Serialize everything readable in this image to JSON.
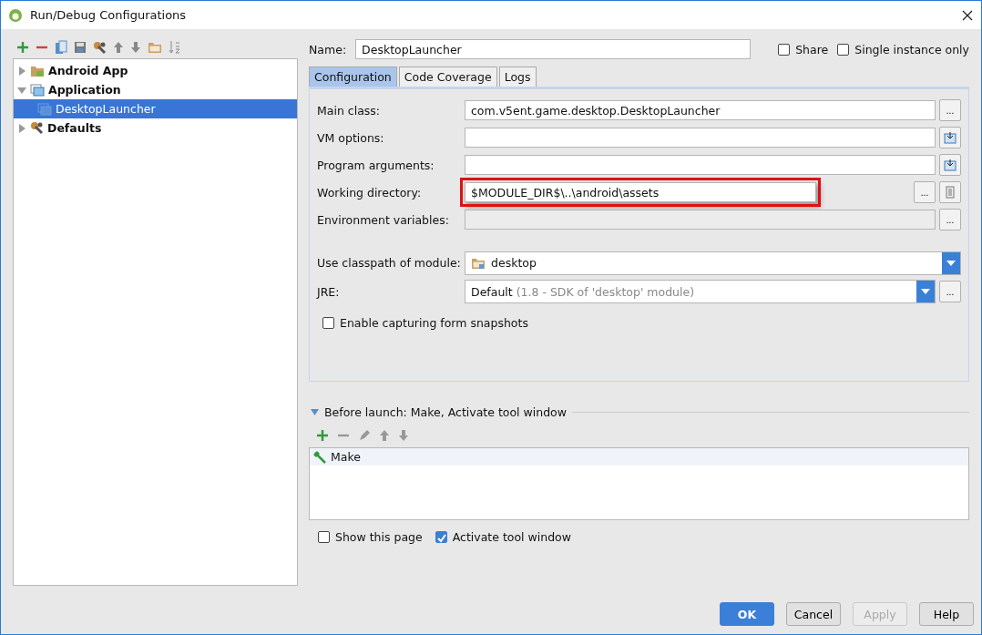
{
  "window": {
    "title": "Run/Debug Configurations"
  },
  "tree": [
    {
      "label": "Android App",
      "expanded": false,
      "selected": false
    },
    {
      "label": "Application",
      "expanded": true,
      "selected": false,
      "children": [
        {
          "label": "DesktopLauncher",
          "selected": true
        }
      ]
    },
    {
      "label": "Defaults",
      "expanded": false,
      "selected": false
    }
  ],
  "name_field": {
    "label": "Name:",
    "value": "DesktopLauncher"
  },
  "header_checks": [
    {
      "label": "Share",
      "checked": false
    },
    {
      "label": "Single instance only",
      "checked": false
    }
  ],
  "tabs": [
    {
      "label": "Configuration",
      "selected": true
    },
    {
      "label": "Code Coverage",
      "selected": false
    },
    {
      "label": "Logs",
      "selected": false
    }
  ],
  "fields": [
    {
      "label": "Main class:",
      "kind": "text",
      "value": "com.v5ent.game.desktop.DesktopLauncher",
      "browse": "...",
      "highlighted": false,
      "disabled": false
    },
    {
      "label": "VM options:",
      "kind": "expand",
      "highlighted": false,
      "disabled": false
    },
    {
      "label": "Program arguments:",
      "kind": "expand",
      "highlighted": false,
      "disabled": false
    },
    {
      "label": "Working directory:",
      "kind": "dir",
      "value": "$MODULE_DIR$\\..\\android\\assets",
      "browse": "...",
      "highlighted": true,
      "disabled": false
    },
    {
      "label": "Environment variables:",
      "kind": "text",
      "browse": "...",
      "highlighted": false,
      "disabled": true
    },
    {
      "label": "Use classpath of module:",
      "kind": "module",
      "value": "desktop",
      "highlighted": false,
      "disabled": false
    },
    {
      "label": "JRE:",
      "kind": "combo",
      "value": "Default",
      "hint": "(1.8 - SDK of 'desktop' module)",
      "browse": "...",
      "highlighted": false,
      "disabled": false
    }
  ],
  "snapshots": {
    "label": "Enable capturing form snapshots",
    "checked": false
  },
  "before_launch": {
    "title": "Before launch: Make, Activate tool window",
    "expanded": true,
    "tasks": [
      {
        "label": "Make",
        "selected": true
      }
    ],
    "options": [
      {
        "label": "Show this page",
        "checked": false
      },
      {
        "label": "Activate tool window",
        "checked": true
      }
    ]
  },
  "buttons": [
    {
      "label": "OK",
      "kind": "primary",
      "disabled": false
    },
    {
      "label": "Cancel",
      "kind": "normal",
      "disabled": false
    },
    {
      "label": "Apply",
      "kind": "normal",
      "disabled": true
    },
    {
      "label": "Help",
      "kind": "normal",
      "disabled": false
    }
  ]
}
